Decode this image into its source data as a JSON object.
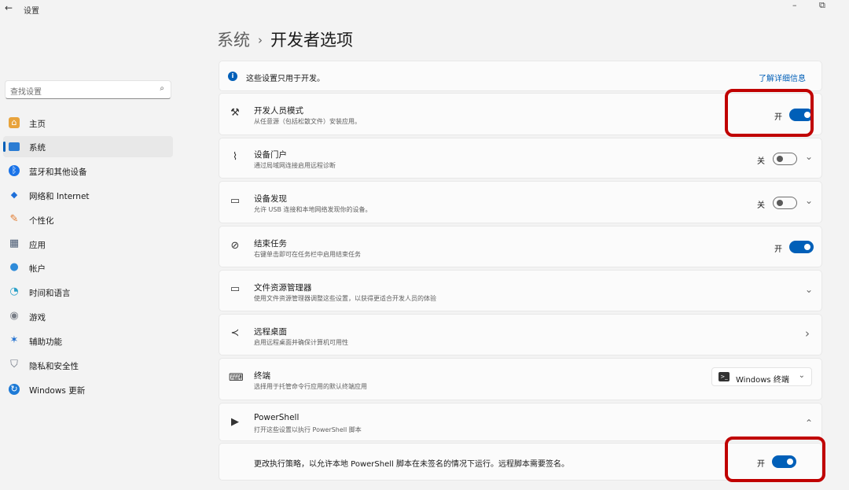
{
  "window": {
    "app_title": "设置",
    "back_icon": "←",
    "minimize_icon": "–",
    "restore_icon": "⧉"
  },
  "search": {
    "placeholder": "查找设置",
    "icon": "⌕"
  },
  "sidebar": {
    "items": [
      {
        "label": "主页",
        "icon": "home-icon",
        "glyph": "⌂",
        "color": "#e8a33c",
        "active": false
      },
      {
        "label": "系统",
        "icon": "monitor-icon",
        "glyph": "",
        "color": "#2b7cd3",
        "active": true
      },
      {
        "label": "蓝牙和其他设备",
        "icon": "bluetooth-icon",
        "glyph": "ᛒ",
        "color": "#1a73e8",
        "active": false
      },
      {
        "label": "网络和 Internet",
        "icon": "wifi-icon",
        "glyph": "◆",
        "color": "#1e6fd9",
        "active": false
      },
      {
        "label": "个性化",
        "icon": "brush-icon",
        "glyph": "✎",
        "color": "#e27b2f",
        "active": false
      },
      {
        "label": "应用",
        "icon": "apps-icon",
        "glyph": "▦",
        "color": "#4a5b73",
        "active": false
      },
      {
        "label": "帐户",
        "icon": "person-icon",
        "glyph": "●",
        "color": "#2e8bd9",
        "active": false
      },
      {
        "label": "时间和语言",
        "icon": "globe-clock-icon",
        "glyph": "◔",
        "color": "#2aa0c8",
        "active": false
      },
      {
        "label": "游戏",
        "icon": "gamepad-icon",
        "glyph": "◉",
        "color": "#7a7f88",
        "active": false
      },
      {
        "label": "辅助功能",
        "icon": "accessibility-icon",
        "glyph": "✶",
        "color": "#1f6fd0",
        "active": false
      },
      {
        "label": "隐私和安全性",
        "icon": "shield-icon",
        "glyph": "⛉",
        "color": "#6b7380",
        "active": false
      },
      {
        "label": "Windows 更新",
        "icon": "update-icon",
        "glyph": "↻",
        "color": "#1d7ad6",
        "active": false
      }
    ]
  },
  "breadcrumb": {
    "parent": "系统",
    "separator": "›",
    "current": "开发者选项"
  },
  "info_bar": {
    "text": "这些设置只用于开发。",
    "link": "了解详细信息"
  },
  "rows": {
    "developer_mode": {
      "title": "开发人员模式",
      "subtitle": "从任意源（包括松散文件）安装应用。",
      "state": "开",
      "on": true,
      "icon": "tools-icon",
      "glyph": "⚒"
    },
    "device_portal": {
      "title": "设备门户",
      "subtitle": "通过局域网连接启用远程诊断",
      "state": "关",
      "on": false,
      "icon": "pulse-icon",
      "glyph": "⌇"
    },
    "device_discovery": {
      "title": "设备发现",
      "subtitle": "允许 USB 连接和本地网络发现你的设备。",
      "state": "关",
      "on": false,
      "icon": "cast-icon",
      "glyph": "▭"
    },
    "end_task": {
      "title": "结束任务",
      "subtitle": "右键单击即可在任务栏中启用结束任务",
      "state": "开",
      "on": true,
      "icon": "blocked-icon",
      "glyph": "⊘"
    },
    "file_explorer": {
      "title": "文件资源管理器",
      "subtitle": "使用文件资源管理器调整这些设置，以获得更适合开发人员的体验",
      "icon": "folder-icon",
      "glyph": "🗀"
    },
    "remote_desktop": {
      "title": "远程桌面",
      "subtitle": "启用远程桌面并确保计算机可用性",
      "icon": "remote-icon",
      "glyph": "≺"
    },
    "terminal": {
      "title": "终端",
      "subtitle": "选择用于托管命令行应用的默认终端应用",
      "dropdown_value": "Windows 终端",
      "icon": "terminal-icon",
      "glyph": "⌨"
    },
    "powershell": {
      "title": "PowerShell",
      "subtitle": "打开这些设置以执行 PowerShell 脚本",
      "icon": "powershell-icon",
      "glyph": "▶"
    },
    "execution_policy": {
      "text": "更改执行策略，以允许本地 PowerShell 脚本在未签名的情况下运行。远程脚本需要签名。",
      "state": "开",
      "on": true
    }
  },
  "chevrons": {
    "down": "⌄",
    "right": "›",
    "up": "⌃"
  },
  "highlight_color": "#c00000"
}
